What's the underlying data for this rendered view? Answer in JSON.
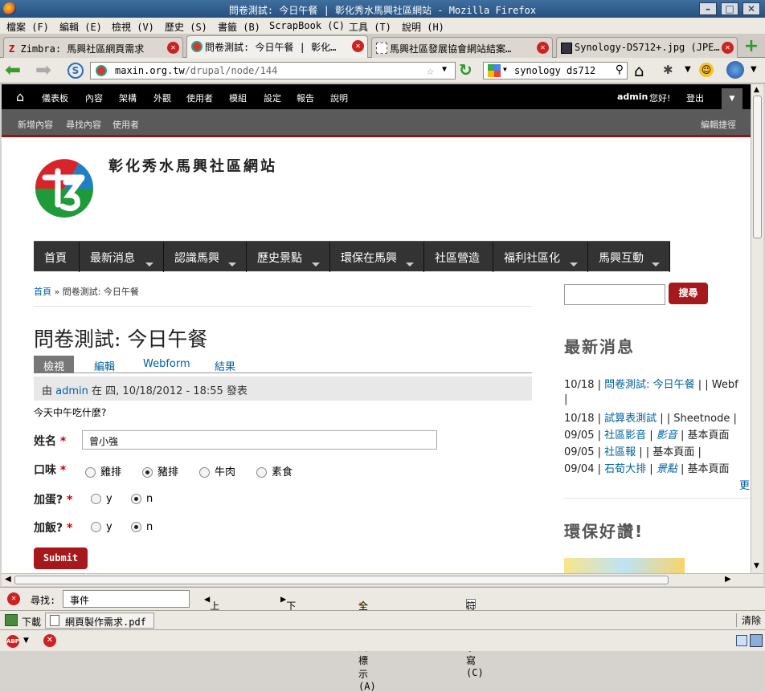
{
  "window": {
    "title": "問卷測試: 今日午餐 | 彰化秀水馬興社區網站 - Mozilla Firefox"
  },
  "menu": [
    "檔案 (F)",
    "編輯 (E)",
    "檢視 (V)",
    "歷史 (S)",
    "書籤 (B)",
    "ScrapBook (C)",
    "工具 (T)",
    "說明 (H)"
  ],
  "tabs": [
    {
      "label": "Zimbra: 馬興社區網頁需求"
    },
    {
      "label": "問卷測試: 今日午餐 | 彰化…"
    },
    {
      "label": "馬興社區發展協會網站結案…"
    },
    {
      "label": "Synology-DS712+.jpg (JPE…"
    }
  ],
  "urlbar": {
    "host": "maxin.org.tw",
    "path": "/drupal/node/144"
  },
  "searchbar": {
    "value": "synology ds712"
  },
  "admin_toolbar": {
    "items": [
      "儀表板",
      "內容",
      "架構",
      "外觀",
      "使用者",
      "模組",
      "設定",
      "報告",
      "說明"
    ],
    "user_greeting_name": "admin",
    "user_greeting_text": "您好!",
    "logout": "登出"
  },
  "shortcuts": {
    "items": [
      "新增內容",
      "尋找內容",
      "使用者"
    ],
    "edit": "編輯捷徑"
  },
  "site": {
    "name": "彰化秀水馬興社區網站"
  },
  "main_nav": [
    "首頁",
    "最新消息",
    "認識馬興",
    "歷史景點",
    "環保在馬興",
    "社區營造",
    "福利社區化",
    "馬興互動"
  ],
  "breadcrumb": {
    "home": "首頁",
    "sep": "»",
    "current": "問卷測試: 今日午餐"
  },
  "node": {
    "title": "問卷測試: 今日午餐",
    "local_tabs": [
      "檢視",
      "編輯",
      "Webform",
      "結果"
    ],
    "submitted_by": "由",
    "author": "admin",
    "submitted_rest": "在 四, 10/18/2012 - 18:55 發表",
    "body": "今天中午吃什麼?"
  },
  "form": {
    "name_label": "姓名",
    "name_value": "曾小強",
    "taste_label": "口味",
    "taste_options": [
      "雞排",
      "豬排",
      "牛肉",
      "素食"
    ],
    "taste_selected": "豬排",
    "egg_label": "加蛋?",
    "rice_label": "加飯?",
    "yn_options": [
      "y",
      "n"
    ],
    "egg_selected": "n",
    "rice_selected": "n",
    "required_mark": "*",
    "submit": "Submit"
  },
  "sidebar": {
    "search_button": "搜尋",
    "latest_title": "最新消息",
    "latest": [
      {
        "date": "10/18",
        "title": "問卷測試: 今日午餐",
        "tag": "",
        "type": "| Webf"
      },
      {
        "date": "10/18",
        "title": "試算表測試",
        "tag": "",
        "type": "| Sheetnode |"
      },
      {
        "date": "09/05",
        "title": "社區影音",
        "tag": "影音",
        "type": "基本頁面"
      },
      {
        "date": "09/05",
        "title": "社區報",
        "tag": "",
        "type": "| 基本頁面 |"
      },
      {
        "date": "09/04",
        "title": "石荀大排",
        "tag": "景點",
        "type": "基本頁面"
      }
    ],
    "more": "更",
    "green_title": "環保好讚!"
  },
  "findbar": {
    "label": "尋找:",
    "value": "事件",
    "prev": "上一筆 (P)",
    "next": "下一筆 (N)",
    "highlight": "全部強調標示 (A)",
    "match_case": "符合大小寫 (C)"
  },
  "downloads": {
    "label": "下載",
    "file": "網頁製作需求.pdf",
    "clear": "清除"
  },
  "colors": {
    "accent": "#a7181c",
    "link": "#0062a0",
    "nav_bg": "#333333"
  }
}
